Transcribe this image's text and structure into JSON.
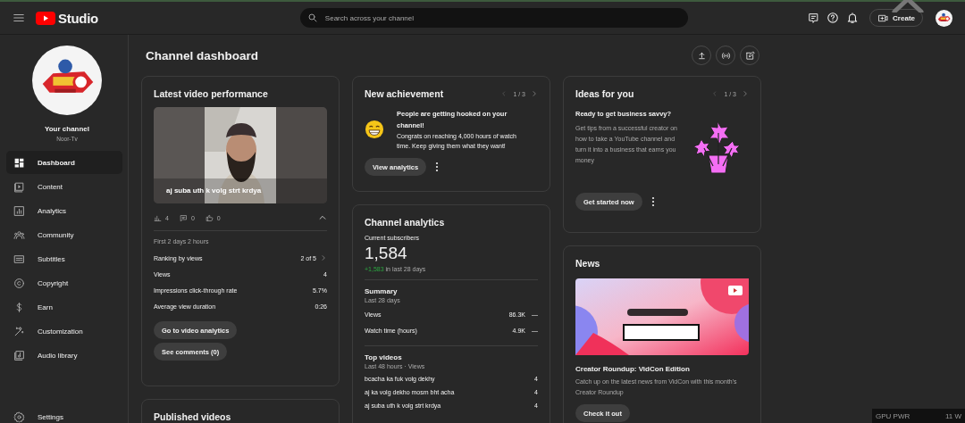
{
  "header": {
    "logo_text": "Studio",
    "search": {
      "placeholder": "Search across your channel"
    },
    "create_label": "Create"
  },
  "sidebar": {
    "channel_label": "Your channel",
    "channel_name": "Noor-Tv",
    "items": [
      {
        "label": "Dashboard",
        "selected": true
      },
      {
        "label": "Content",
        "selected": false
      },
      {
        "label": "Analytics",
        "selected": false
      },
      {
        "label": "Community",
        "selected": false
      },
      {
        "label": "Subtitles",
        "selected": false
      },
      {
        "label": "Copyright",
        "selected": false
      },
      {
        "label": "Earn",
        "selected": false
      },
      {
        "label": "Customization",
        "selected": false
      },
      {
        "label": "Audio library",
        "selected": false
      }
    ],
    "settings_label": "Settings"
  },
  "page_title": "Channel dashboard",
  "latest_video": {
    "title": "Latest video performance",
    "thumbnail": {
      "kind": "picture"
    },
    "video_title": "aj suba uth k volg strt krdya",
    "stats": [
      "4",
      "0",
      "0"
    ],
    "expanded": true,
    "period": "First 2 days 2 hours",
    "metrics": [
      {
        "label": "Ranking by views",
        "value": "2 of 5",
        "kind": "link"
      },
      {
        "label": "Views",
        "value": "4",
        "kind": "plain"
      },
      {
        "label": "Impressions click-through rate",
        "value": "5.7%",
        "kind": "plain"
      },
      {
        "label": "Average view duration",
        "value": "0:26",
        "kind": "plain"
      }
    ],
    "buttons": [
      "Go to video analytics",
      "See comments (0)"
    ]
  },
  "published_videos": {
    "title": "Published videos"
  },
  "achievement": {
    "title": "New achievement",
    "pager": "1 / 3",
    "headline": "People are getting hooked on your channel!",
    "body": "Congrats on reaching 4,000 hours of watch time. Keep giving them what they want!",
    "button": "View analytics"
  },
  "analytics": {
    "title": "Channel analytics",
    "subscribers_label": "Current subscribers",
    "subscribers": "1,584",
    "change": "+1,583",
    "change_suffix": "in last 28 days",
    "summary_title": "Summary",
    "summary_period": "Last 28 days",
    "summary": [
      {
        "label": "Views",
        "value": "86.3K",
        "trend": "—"
      },
      {
        "label": "Watch time (hours)",
        "value": "4.9K",
        "trend": "—"
      }
    ],
    "top_title": "Top videos",
    "top_period": "Last 48 hours · Views",
    "top_videos": [
      {
        "title": "bcacha ka fuk volg dekhy",
        "views": "4"
      },
      {
        "title": "aj ka volg dekho mosm bht acha",
        "views": "4"
      },
      {
        "title": "aj suba uth k volg strt krdya",
        "views": "4"
      }
    ]
  },
  "ideas": {
    "title": "Ideas for you",
    "pager": "1 / 3",
    "headline": "Ready to get business savvy?",
    "body": "Get tips from a successful creator on how to take a YouTube channel and turn it into a business that earns you money",
    "button": "Get started now"
  },
  "news": {
    "title": "News",
    "image": {
      "kind": "picture"
    },
    "headline": "Creator Roundup: VidCon Edition",
    "body": "Catch up on the latest news from VidCon with this month's Creator Roundup",
    "button": "Check it out"
  },
  "overlay": {
    "label": "GPU PWR",
    "value": "11 W"
  }
}
